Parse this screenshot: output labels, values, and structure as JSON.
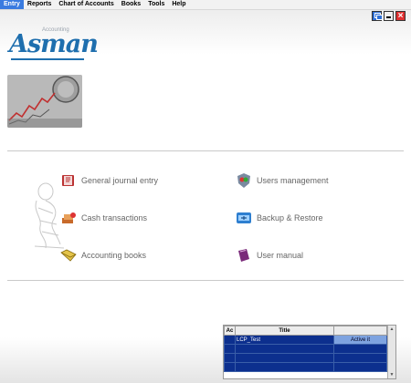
{
  "menu": {
    "items": [
      {
        "label": "Entry",
        "active": true
      },
      {
        "label": "Reports"
      },
      {
        "label": "Chart of Accounts"
      },
      {
        "label": "Books"
      },
      {
        "label": "Tools"
      },
      {
        "label": "Help"
      }
    ]
  },
  "brand": {
    "name": "Asman",
    "subtitle": "Accounting"
  },
  "features": {
    "general_journal": "General journal entry",
    "cash_transactions": "Cash transactions",
    "accounting_books": "Accounting books",
    "users_management": "Users management",
    "backup_restore": "Backup & Restore",
    "user_manual": "User manual"
  },
  "grid": {
    "col_active": "Ac",
    "col_title": "Title",
    "row_title": "LCP_Test",
    "row_status": "Active it"
  },
  "colors": {
    "accent": "#1f6fae",
    "grid_row": "#0c2f8e"
  }
}
